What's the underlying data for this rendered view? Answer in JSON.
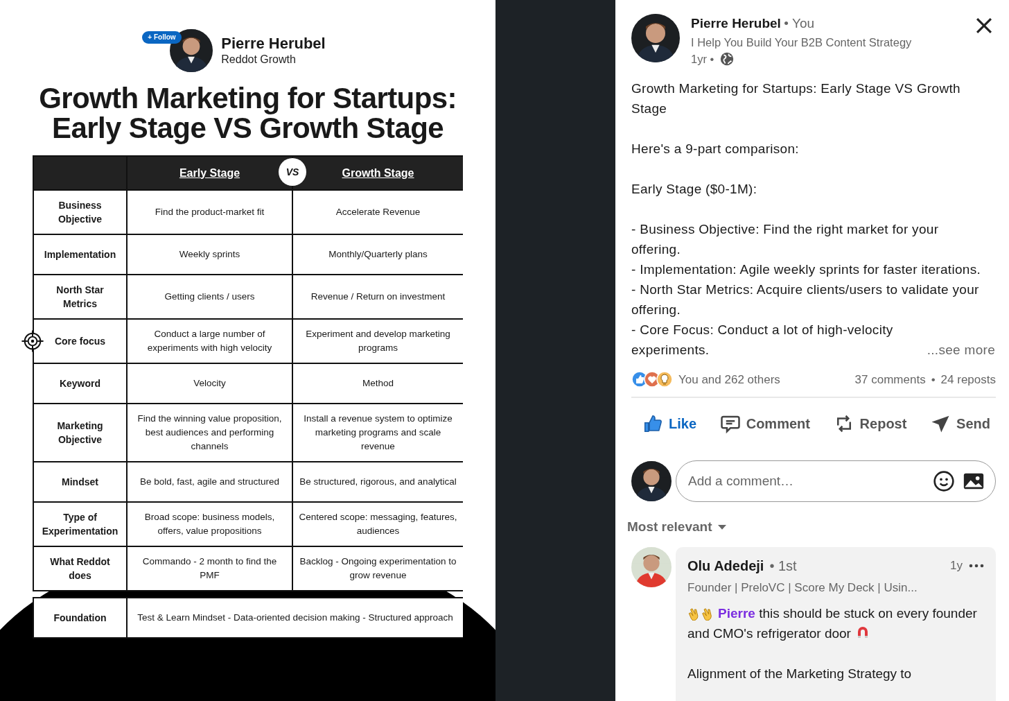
{
  "infographic": {
    "follow_label": "+ Follow",
    "author": "Pierre Herubel",
    "company": "Reddot Growth",
    "title_lines": [
      "Growth Marketing for Startups:",
      "Early Stage VS Growth Stage"
    ],
    "table": {
      "columns": [
        "Early Stage",
        "Growth Stage"
      ],
      "vs": "VS",
      "rows": [
        {
          "label": "Business Objective",
          "early": "Find the product-market fit",
          "growth": "Accelerate Revenue",
          "target": false
        },
        {
          "label": "Implementation",
          "early": "Weekly sprints",
          "growth": "Monthly/Quarterly plans",
          "target": false
        },
        {
          "label": "North Star Metrics",
          "early": "Getting clients / users",
          "growth": "Revenue / Return on investment",
          "target": false
        },
        {
          "label": "Core focus",
          "early": "Conduct a large number of experiments with high velocity",
          "growth": "Experiment and develop marketing programs",
          "target": true
        },
        {
          "label": "Keyword",
          "early": "Velocity",
          "growth": "Method",
          "target": false
        },
        {
          "label": "Marketing Objective",
          "early": "Find the winning value proposition, best audiences and performing channels",
          "growth": "Install a revenue system to optimize marketing programs and scale revenue",
          "target": false
        },
        {
          "label": "Mindset",
          "early": "Be bold, fast, agile and structured",
          "growth": "Be structured, rigorous, and analytical",
          "target": false
        },
        {
          "label": "Type of Experimentation",
          "early": "Broad scope: business models, offers, value propositions",
          "growth": "Centered scope: messaging, features, audiences",
          "target": false
        },
        {
          "label": "What Reddot does",
          "early": "Commando - 2 month to find the PMF",
          "growth": "Backlog - Ongoing experimentation to grow revenue",
          "target": false
        }
      ],
      "footer": {
        "label": "Foundation",
        "text": "Test & Learn Mindset - Data-oriented decision making - Structured approach"
      }
    }
  },
  "post": {
    "author": "Pierre Herubel",
    "relation": "• You",
    "headline": "I Help You Build Your B2B Content Strategy",
    "age": "1yr •",
    "paragraphs": [
      [
        "Growth Marketing for Startups: Early Stage VS Growth Stage"
      ],
      [
        "Here's a 9-part comparison:"
      ],
      [
        "Early Stage ($0-1M):"
      ],
      [
        "- Business Objective: Find the right market for your offering.",
        "- Implementation: Agile weekly sprints for faster iterations.",
        "- North Star Metrics: Acquire clients/users to validate your offering.",
        "- Core Focus: Conduct a lot of high-velocity experiments."
      ]
    ],
    "see_more": "...see more",
    "reactions": "You and 262 others",
    "comments": "37 comments",
    "separator": "•",
    "reposts": "24 reposts",
    "liked": true,
    "actions": [
      {
        "label": "Like",
        "kind": "like"
      },
      {
        "label": "Comment",
        "kind": "comment"
      },
      {
        "label": "Repost",
        "kind": "repost"
      },
      {
        "label": "Send",
        "kind": "send"
      }
    ],
    "comment_box": {
      "placeholder": "Add a comment…"
    },
    "sort": "Most relevant",
    "comment_list": [
      {
        "name": "Olu Adedeji",
        "degree": "• 1st",
        "time": "1y",
        "headline": "Founder | PreloVC | Score My Deck | Usin...",
        "mention": "Pierre",
        "text": "this should be stuck on every founder and CMO's refrigerator door",
        "more_text": "Alignment of the Marketing Strategy to"
      }
    ]
  }
}
